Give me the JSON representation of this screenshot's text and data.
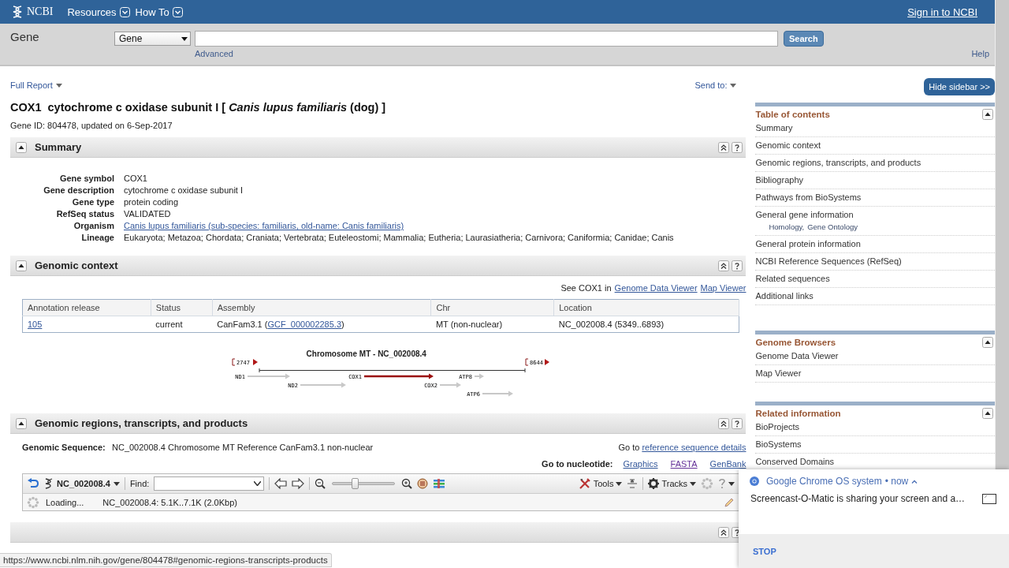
{
  "header": {
    "logo": "NCBI",
    "menus": [
      {
        "label": "Resources"
      },
      {
        "label": "How To"
      }
    ],
    "sign_in": "Sign in to NCBI"
  },
  "search": {
    "database": "Gene",
    "db_select": "Gene",
    "button": "Search",
    "advanced": "Advanced",
    "help": "Help"
  },
  "report_bar": {
    "format": "Full Report",
    "send_to": "Send to:"
  },
  "title": {
    "symbol": "COX1",
    "name": "cytochrome c oxidase subunit I [ *Canis lupus familiaris* (dog) ]"
  },
  "gene_id": "Gene ID: 804478, updated on 6-Sep-2017",
  "summary": {
    "title": "Summary",
    "expanded": true,
    "fields": [
      {
        "label": "Gene symbol",
        "value": "COX1",
        "kind": "text"
      },
      {
        "label": "Gene description",
        "value": "cytochrome c oxidase subunit I",
        "kind": "text"
      },
      {
        "label": "Gene type",
        "value": "protein coding",
        "kind": "text"
      },
      {
        "label": "RefSeq status",
        "value": "VALIDATED",
        "kind": "text"
      },
      {
        "label": "Organism",
        "value": "Canis lupus familiaris (sub-species: familiaris, old-name: Canis familiaris)",
        "kind": "link"
      },
      {
        "label": "Lineage",
        "value": "Eukaryota; Metazoa; Chordata; Craniata; Vertebrata; Euteleostomi; Mammalia; Eutheria; Laurasiatheria; Carnivora; Caniformia; Canidae; Canis",
        "kind": "text"
      }
    ]
  },
  "genomic_context": {
    "title": "Genomic context",
    "expanded": true,
    "see_in": "See COX1 in",
    "viewer_links": [
      "Genome Data Viewer",
      "Map Viewer"
    ],
    "table": {
      "columns": [
        "Annotation release",
        "Status",
        "Assembly",
        "Chr",
        "Location"
      ],
      "rows": [
        {
          "cells": [
            {
              "kind": "link",
              "text": "105"
            },
            {
              "kind": "text",
              "text": "current"
            },
            {
              "kind": "mixed",
              "before": "CanFam3.1 (",
              "link": "GCF_000002285.3",
              "after": ")"
            },
            {
              "kind": "text",
              "text": "MT (non-nuclear)"
            },
            {
              "kind": "text",
              "text": "NC_002008.4 (5349..6893)"
            }
          ]
        }
      ]
    },
    "map": {
      "title": "Chromosome MT - NC_002008.4",
      "start": "2747",
      "end": "8644",
      "genes": [
        {
          "name": "ND1",
          "selected": false
        },
        {
          "name": "ND2",
          "selected": false
        },
        {
          "name": "COX1",
          "selected": true
        },
        {
          "name": "COX2",
          "selected": false
        },
        {
          "name": "ATP8",
          "selected": false
        },
        {
          "name": "ATP6",
          "selected": false
        }
      ]
    }
  },
  "regions": {
    "title": "Genomic regions, transcripts, and products",
    "expanded": true,
    "sequence_label": "Genomic Sequence:",
    "sequence": "NC_002008.4 Chromosome MT Reference CanFam3.1 non-nuclear",
    "goto": "Go to",
    "goto_link": "reference sequence details",
    "nucleotide_label": "Go to nucleotide:",
    "nucleotide_links": [
      {
        "label": "Graphics",
        "visited": false
      },
      {
        "label": "FASTA",
        "visited": true
      },
      {
        "label": "GenBank",
        "visited": false
      }
    ],
    "viewer": {
      "sequence": "NC_002008.4",
      "find_label": "Find:",
      "level": 0.35,
      "tools": "Tools",
      "tracks": "Tracks",
      "loading": "Loading...",
      "range": "NC_002008.4: 5.1K..7.1K (2.0Kbp)"
    }
  },
  "sidebar": {
    "hide_button": "Hide sidebar >>",
    "panels": [
      {
        "title": "Table of contents",
        "expanded": true,
        "items": [
          {
            "label": "Summary"
          },
          {
            "label": "Genomic context"
          },
          {
            "label": "Genomic regions, transcripts, and products"
          },
          {
            "label": "Bibliography"
          },
          {
            "label": "Pathways from BioSystems"
          },
          {
            "label": "General gene information",
            "sublinks": [
              "Homology,",
              "Gene Ontology"
            ]
          },
          {
            "label": "General protein information"
          },
          {
            "label": "NCBI Reference Sequences (RefSeq)"
          },
          {
            "label": "Related sequences"
          },
          {
            "label": "Additional links"
          }
        ]
      },
      {
        "title": "Genome Browsers",
        "expanded": true,
        "items": [
          {
            "label": "Genome Data Viewer"
          },
          {
            "label": "Map Viewer"
          }
        ]
      },
      {
        "title": "Related information",
        "expanded": true,
        "items": [
          {
            "label": "BioProjects"
          },
          {
            "label": "BioSystems"
          },
          {
            "label": "Conserved Domains"
          }
        ]
      }
    ]
  },
  "notification": {
    "app": "Google Chrome OS system",
    "time": "• now",
    "message": "Screencast-O-Matic is sharing your screen and a…",
    "action": "STOP"
  },
  "status_url": "https://www.ncbi.nlm.nih.gov/gene/804478#genomic-regions-transcripts-products"
}
